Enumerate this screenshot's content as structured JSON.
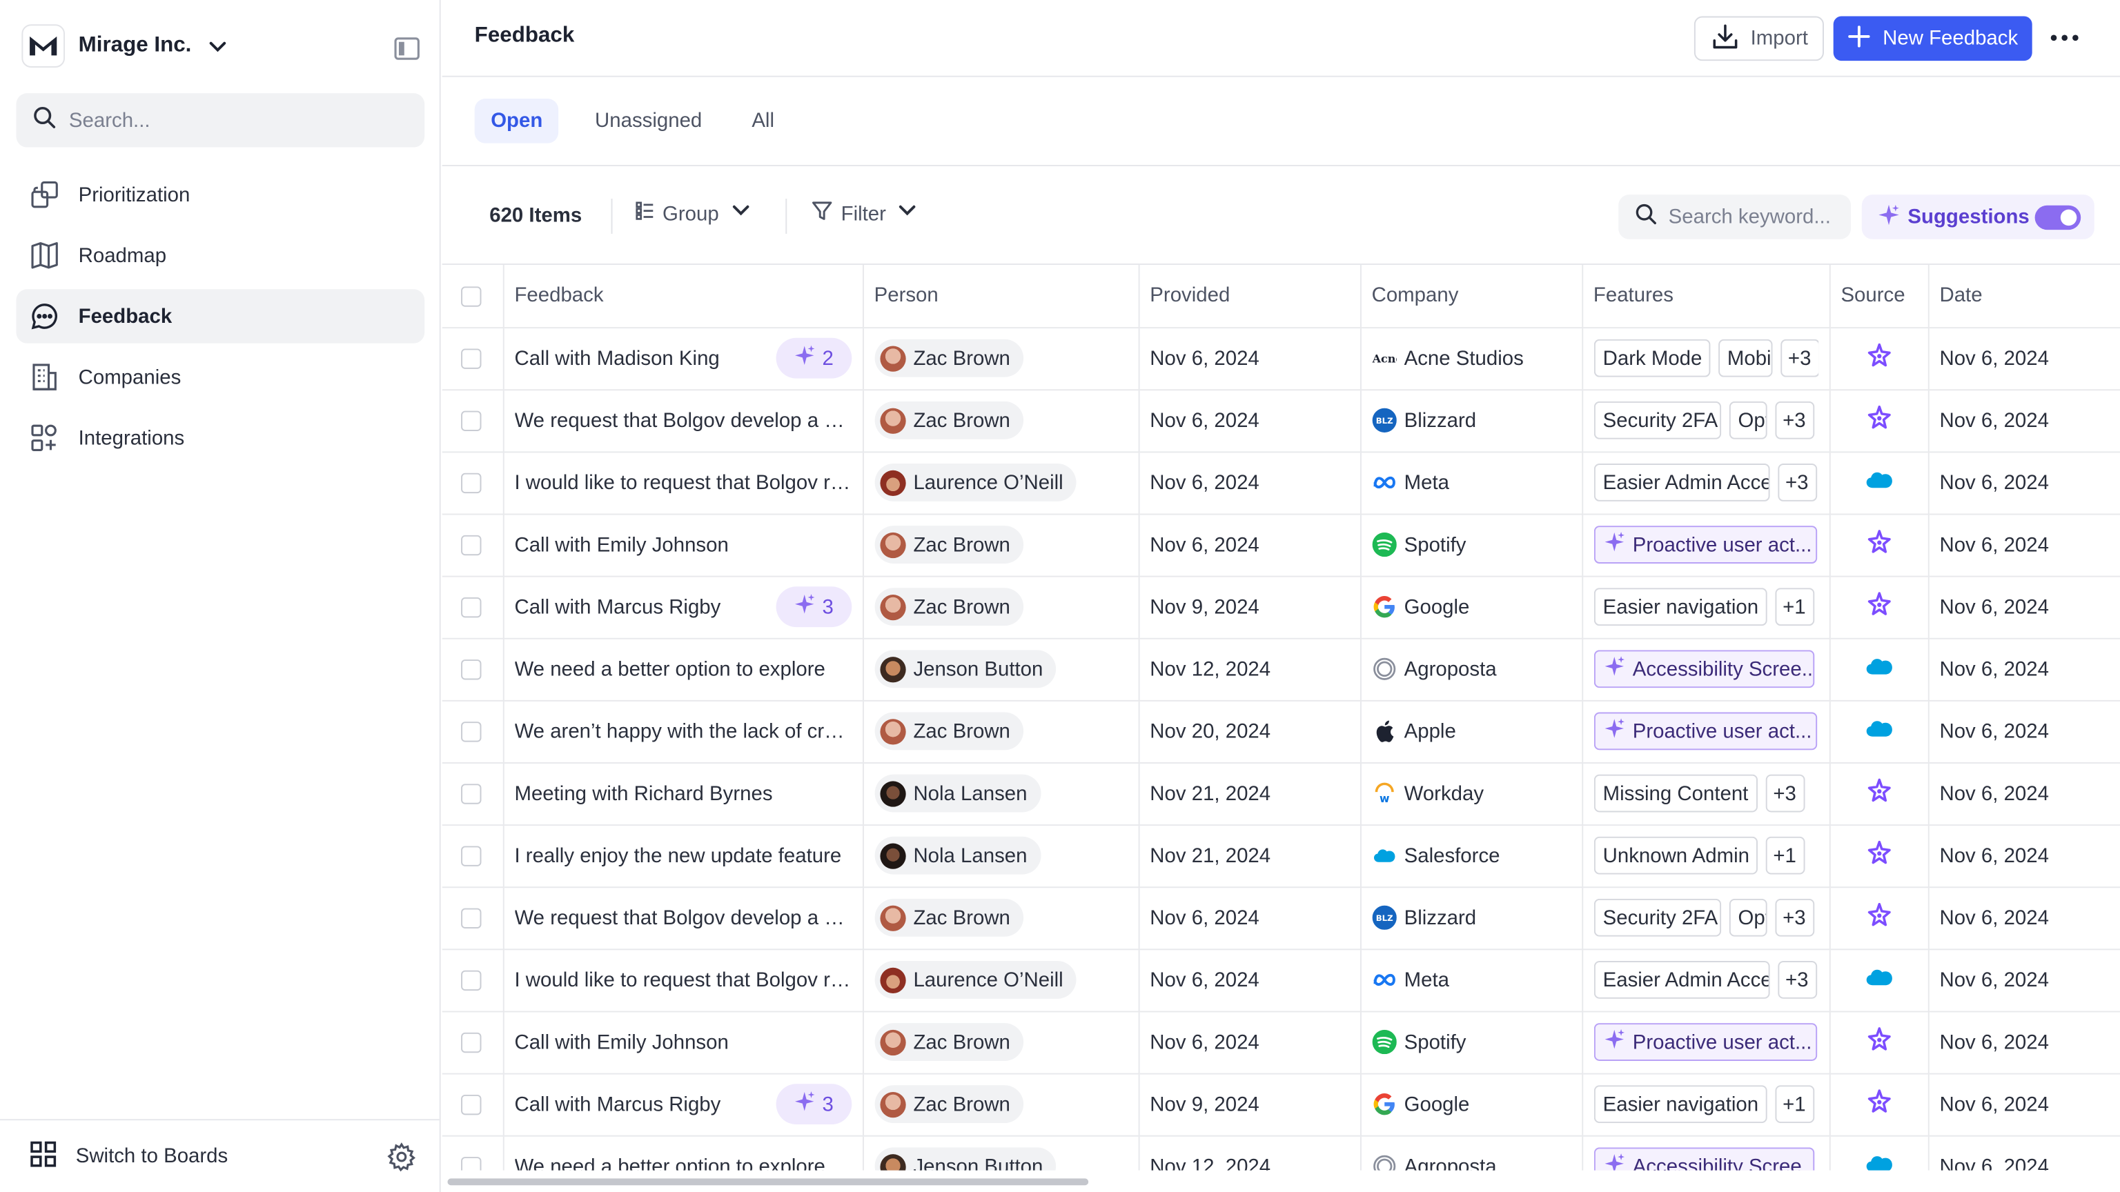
{
  "sidebar": {
    "org_name": "Mirage Inc.",
    "search_placeholder": "Search...",
    "nav": [
      {
        "label": "Prioritization",
        "icon": "layers-icon"
      },
      {
        "label": "Roadmap",
        "icon": "map-icon"
      },
      {
        "label": "Feedback",
        "icon": "message-icon",
        "active": true
      },
      {
        "label": "Companies",
        "icon": "building-icon"
      },
      {
        "label": "Integrations",
        "icon": "integrations-icon"
      }
    ],
    "footer_label": "Switch to Boards"
  },
  "header": {
    "title": "Feedback",
    "import_label": "Import",
    "new_label": "New Feedback"
  },
  "tabs": [
    {
      "label": "Open",
      "active": true
    },
    {
      "label": "Unassigned"
    },
    {
      "label": "All"
    }
  ],
  "toolbar": {
    "count": "620 Items",
    "group_label": "Group",
    "filter_label": "Filter",
    "search_placeholder": "Search keyword...",
    "suggestions_label": "Suggestions",
    "suggestions_on": true
  },
  "colors": {
    "accent": "#3b5bf2",
    "ai_purple": "#6d4ee0",
    "ai_chip_border": "#b9a2f6"
  },
  "table": {
    "columns": [
      "Feedback",
      "Person",
      "Provided",
      "Company",
      "Features",
      "Source",
      "Date"
    ],
    "rows": [
      {
        "feedback": "Call with Madison King",
        "ai_count": "2",
        "person": "Zac Brown",
        "provided": "Nov 6, 2024",
        "company": "Acne Studios",
        "features": [
          {
            "label": "Dark Mode"
          },
          {
            "label": "Mobile"
          }
        ],
        "more": "+3",
        "source": "ai",
        "date": "Nov 6, 2024"
      },
      {
        "feedback": "We request that Bolgov develop a new feature",
        "person": "Zac Brown",
        "provided": "Nov 6, 2024",
        "company": "Blizzard",
        "features": [
          {
            "label": "Security 2FA"
          },
          {
            "label": "Options"
          }
        ],
        "more": "+3",
        "source": "ai",
        "date": "Nov 6, 2024"
      },
      {
        "feedback": "I would like to request that Bolgov review",
        "person": "Laurence O’Neill",
        "provided": "Nov 6, 2024",
        "company": "Meta",
        "features": [
          {
            "label": "Easier Admin Access"
          }
        ],
        "more": "+3",
        "source": "salesforce",
        "date": "Nov 6, 2024"
      },
      {
        "feedback": "Call with Emily Johnson",
        "person": "Zac Brown",
        "provided": "Nov 6, 2024",
        "company": "Spotify",
        "features": [
          {
            "label": "Proactive user act...",
            "ai": true
          }
        ],
        "more": "",
        "source": "ai",
        "date": "Nov 6, 2024"
      },
      {
        "feedback": "Call with Marcus Rigby",
        "ai_count": "3",
        "person": "Zac Brown",
        "provided": "Nov 9, 2024",
        "company": "Google",
        "features": [
          {
            "label": "Easier navigation"
          }
        ],
        "more": "+1",
        "source": "ai",
        "date": "Nov 6, 2024"
      },
      {
        "feedback": "We need a better option to explore",
        "person": "Jenson Button",
        "provided": "Nov 12, 2024",
        "company": "Agroposta",
        "features": [
          {
            "label": "Accessibility Scree...",
            "ai": true
          }
        ],
        "more": "",
        "source": "salesforce",
        "date": "Nov 6, 2024"
      },
      {
        "feedback": "We aren’t happy with the lack of creative",
        "person": "Zac Brown",
        "provided": "Nov 20, 2024",
        "company": "Apple",
        "features": [
          {
            "label": "Proactive user act...",
            "ai": true
          }
        ],
        "more": "",
        "source": "salesforce",
        "date": "Nov 6, 2024"
      },
      {
        "feedback": "Meeting with Richard Byrnes",
        "person": "Nola Lansen",
        "provided": "Nov 21, 2024",
        "company": "Workday",
        "features": [
          {
            "label": "Missing Content"
          }
        ],
        "more": "+3",
        "source": "ai",
        "date": "Nov 6, 2024"
      },
      {
        "feedback": "I really enjoy the new update feature",
        "person": "Nola Lansen",
        "provided": "Nov 21, 2024",
        "company": "Salesforce",
        "features": [
          {
            "label": "Unknown Admin"
          }
        ],
        "more": "+1",
        "source": "ai",
        "date": "Nov 6, 2024"
      },
      {
        "feedback": "We request that Bolgov develop a new feature",
        "person": "Zac Brown",
        "provided": "Nov 6, 2024",
        "company": "Blizzard",
        "features": [
          {
            "label": "Security 2FA"
          },
          {
            "label": "Options"
          }
        ],
        "more": "+3",
        "source": "ai",
        "date": "Nov 6, 2024"
      },
      {
        "feedback": "I would like to request that Bolgov review",
        "person": "Laurence O’Neill",
        "provided": "Nov 6, 2024",
        "company": "Meta",
        "features": [
          {
            "label": "Easier Admin Access"
          }
        ],
        "more": "+3",
        "source": "salesforce",
        "date": "Nov 6, 2024"
      },
      {
        "feedback": "Call with Emily Johnson",
        "person": "Zac Brown",
        "provided": "Nov 6, 2024",
        "company": "Spotify",
        "features": [
          {
            "label": "Proactive user act...",
            "ai": true
          }
        ],
        "more": "",
        "source": "ai",
        "date": "Nov 6, 2024"
      },
      {
        "feedback": "Call with Marcus Rigby",
        "ai_count": "3",
        "person": "Zac Brown",
        "provided": "Nov 9, 2024",
        "company": "Google",
        "features": [
          {
            "label": "Easier navigation"
          }
        ],
        "more": "+1",
        "source": "ai",
        "date": "Nov 6, 2024"
      },
      {
        "feedback": "We need a better option to explore",
        "person": "Jenson Button",
        "provided": "Nov 12, 2024",
        "company": "Agroposta",
        "features": [
          {
            "label": "Accessibility Scree...",
            "ai": true
          }
        ],
        "more": "",
        "source": "salesforce",
        "date": "Nov 6, 2024"
      }
    ]
  }
}
